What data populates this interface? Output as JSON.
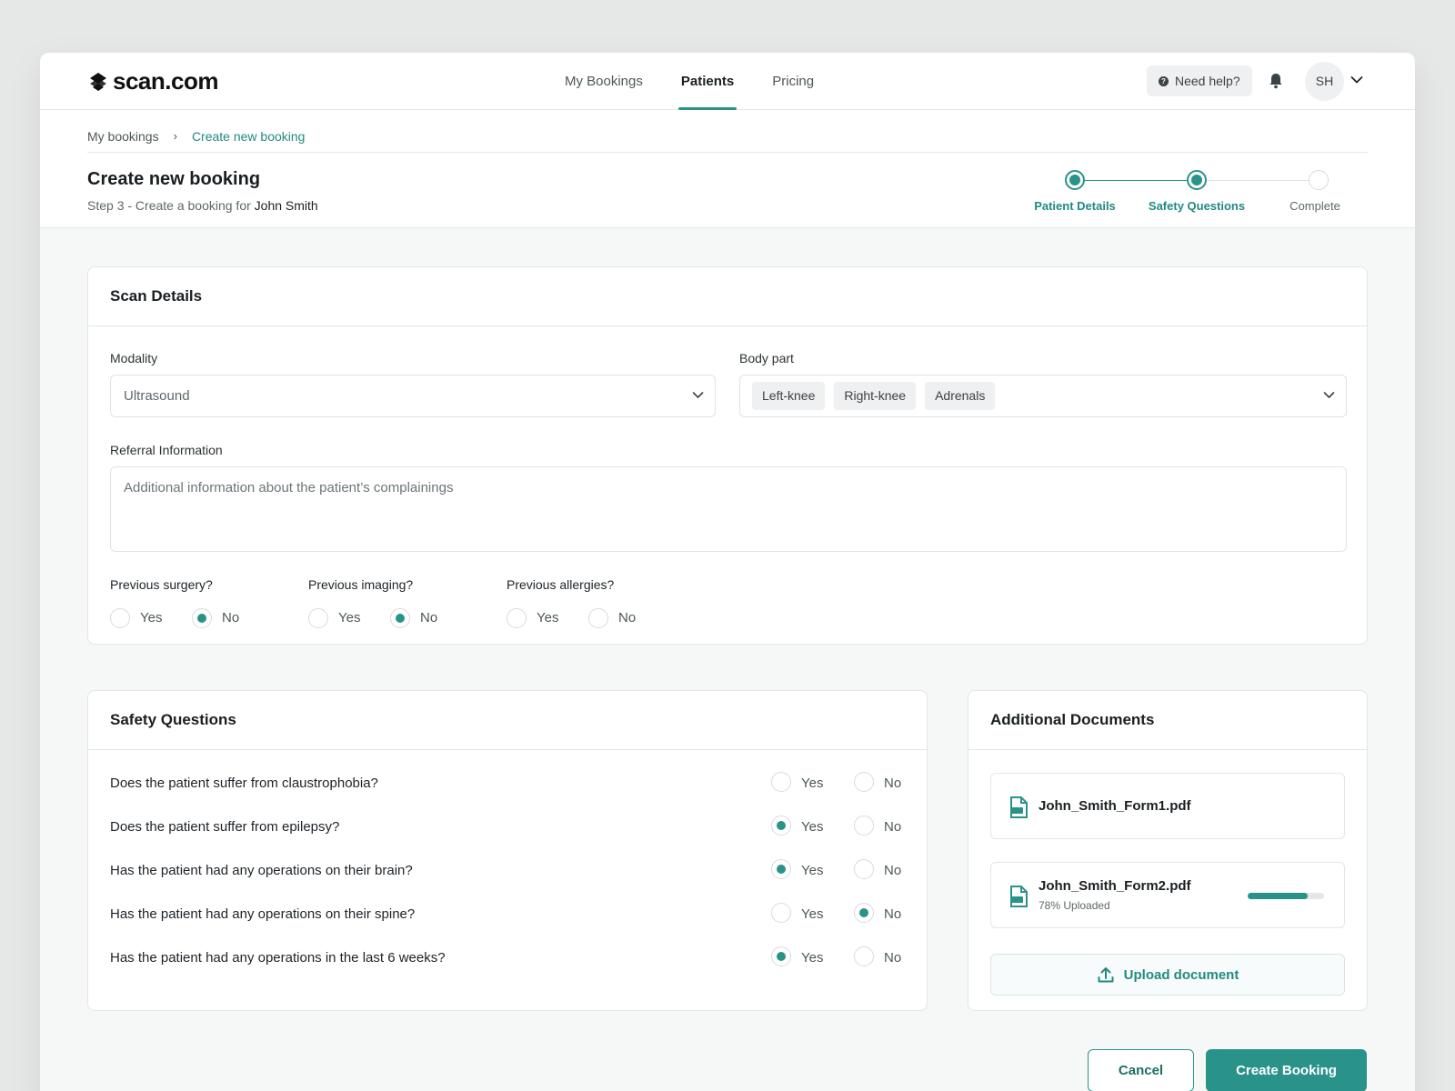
{
  "brand": {
    "name": "scan.com"
  },
  "nav": {
    "items": [
      {
        "label": "My Bookings",
        "active": false
      },
      {
        "label": "Patients",
        "active": true
      },
      {
        "label": "Pricing",
        "active": false
      }
    ],
    "help_label": "Need help?",
    "avatar_initials": "SH"
  },
  "breadcrumb": {
    "root": "My bookings",
    "separator": "›",
    "current": "Create new booking"
  },
  "page": {
    "title": "Create new booking",
    "subtitle_prefix": "Step 3 - Create a booking for ",
    "patient_name": "John Smith"
  },
  "stepper": {
    "steps": [
      {
        "label": "Patient Details",
        "state": "done"
      },
      {
        "label": "Safety Questions",
        "state": "done"
      },
      {
        "label": "Complete",
        "state": "todo"
      }
    ]
  },
  "scan_details": {
    "title": "Scan Details",
    "modality": {
      "label": "Modality",
      "value": "Ultrasound"
    },
    "body_part": {
      "label": "Body part",
      "chips": [
        "Left-knee",
        "Right-knee",
        "Adrenals"
      ]
    },
    "referral": {
      "label": "Referral Information",
      "placeholder": "Additional information about the patient’s complainings"
    },
    "history": [
      {
        "question": "Previous surgery?",
        "yes": "Yes",
        "no": "No",
        "selected": "no"
      },
      {
        "question": "Previous imaging?",
        "yes": "Yes",
        "no": "No",
        "selected": "no"
      },
      {
        "question": "Previous allergies?",
        "yes": "Yes",
        "no": "No",
        "selected": ""
      }
    ]
  },
  "safety": {
    "title": "Safety Questions",
    "yes_label": "Yes",
    "no_label": "No",
    "questions": [
      {
        "text": "Does the patient suffer from claustrophobia?",
        "selected": ""
      },
      {
        "text": "Does the patient suffer from epilepsy?",
        "selected": "yes"
      },
      {
        "text": "Has the patient had any operations on their brain?",
        "selected": "yes"
      },
      {
        "text": "Has the patient had any operations on their spine?",
        "selected": "no"
      },
      {
        "text": "Has the patient had any operations in the last 6 weeks?",
        "selected": "yes"
      }
    ]
  },
  "documents": {
    "title": "Additional Documents",
    "files": [
      {
        "name": "John_Smith_Form1.pdf",
        "status": "",
        "progress": 1.0
      },
      {
        "name": "John_Smith_Form2.pdf",
        "status": "78% Uploaded",
        "progress": 0.78
      }
    ],
    "upload_label": "Upload document"
  },
  "actions": {
    "cancel_label": "Cancel",
    "primary_label": "Create Booking"
  },
  "colors": {
    "accent": "#2a9389",
    "accent_text": "#228a80",
    "background": "#f6f7f7"
  },
  "icons": [
    "brand-logo-icon",
    "question-icon",
    "bell-icon",
    "chevron-down-icon",
    "pdf-file-icon",
    "upload-icon"
  ]
}
